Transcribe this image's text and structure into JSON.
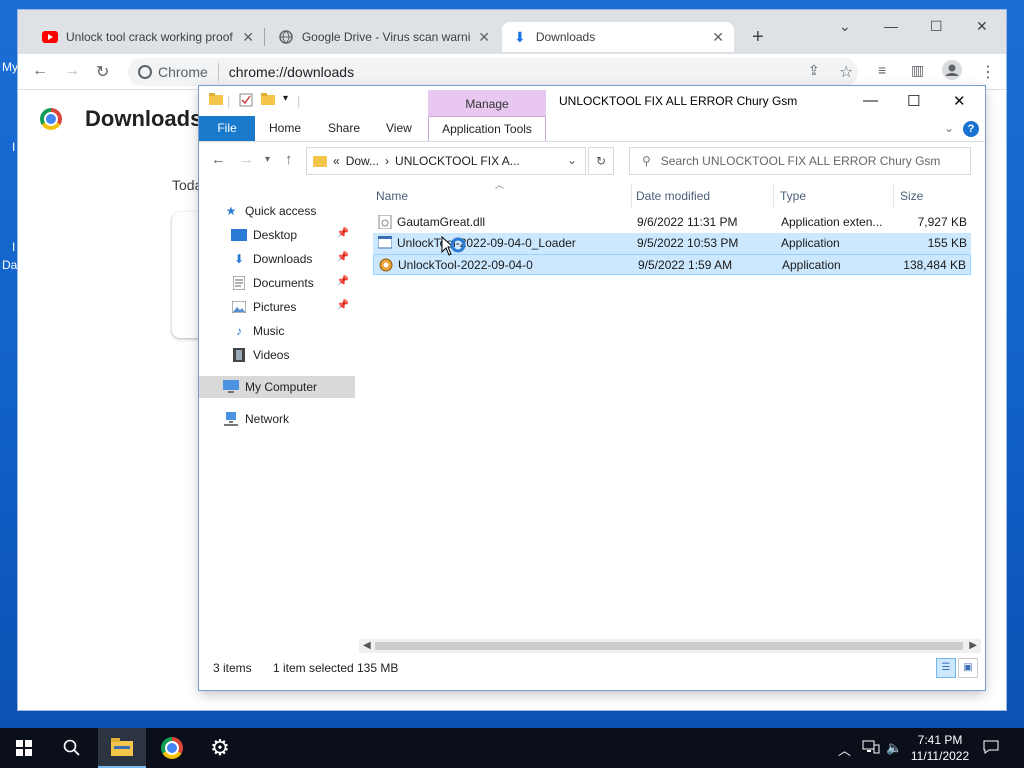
{
  "desktop": {
    "frag1": "My",
    "frag2": "I",
    "frag3": "I",
    "frag4": "Da"
  },
  "chrome": {
    "tabs": [
      {
        "label": "Unlock tool crack working proof"
      },
      {
        "label": "Google Drive - Virus scan warnin"
      },
      {
        "label": "Downloads"
      }
    ],
    "new_tab": "+",
    "omnibox_chip": "Chrome",
    "omnibox_url": "chrome://downloads",
    "page_title": "Downloads",
    "today_label": "Toda"
  },
  "explorer": {
    "manage_label": "Manage",
    "window_title": "UNLOCKTOOL FIX ALL ERROR Chury Gsm",
    "ribbon_tabs": {
      "file": "File",
      "home": "Home",
      "share": "Share",
      "view": "View",
      "app_tools": "Application Tools"
    },
    "help": "?",
    "address_segments": {
      "prefix": "«",
      "seg1": "Dow...",
      "arrow": "›",
      "seg2": "UNLOCKTOOL FIX A..."
    },
    "search_placeholder": "Search UNLOCKTOOL FIX ALL ERROR Chury Gsm",
    "nav": {
      "quick_access": "Quick access",
      "desktop": "Desktop",
      "downloads": "Downloads",
      "documents": "Documents",
      "pictures": "Pictures",
      "music": "Music",
      "videos": "Videos",
      "my_computer": "My Computer",
      "network": "Network"
    },
    "columns": {
      "name": "Name",
      "date": "Date modified",
      "type": "Type",
      "size": "Size"
    },
    "files": [
      {
        "name": "GautamGreat.dll",
        "date": "9/6/2022 11:31 PM",
        "type": "Application exten...",
        "size": "7,927 KB"
      },
      {
        "name": "UnlockTool-2022-09-04-0_Loader",
        "date": "9/5/2022 10:53 PM",
        "type": "Application",
        "size": "155 KB"
      },
      {
        "name": "UnlockTool-2022-09-04-0",
        "date": "9/5/2022 1:59 AM",
        "type": "Application",
        "size": "138,484 KB"
      }
    ],
    "status": {
      "items": "3 items",
      "selected": "1 item selected",
      "size": "135 MB"
    }
  },
  "taskbar": {
    "time": "7:41 PM",
    "date": "11/11/2022"
  },
  "colors": {
    "accent": "#1979ca",
    "selection": "#cce8ff",
    "manage": "#e8c8f0",
    "taskbar": "#0b0f1a"
  }
}
